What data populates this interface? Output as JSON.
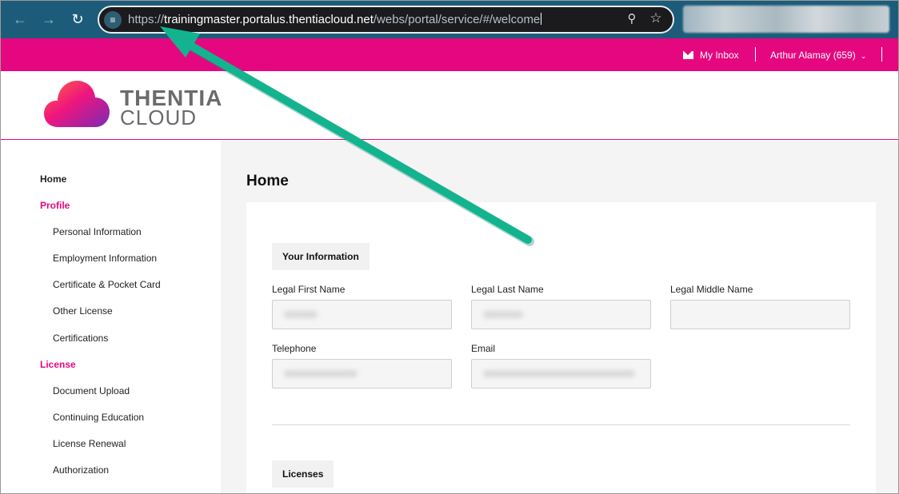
{
  "browser": {
    "url_scheme": "https://",
    "url_host": "trainingmaster.portalus.thentiacloud.net",
    "url_path": "/webs/portal/service/#/welcome",
    "back_icon": "arrow-left",
    "forward_icon": "arrow-right",
    "reload_icon": "reload",
    "site_settings_icon": "tune",
    "zoom_icon": "magnifier-minus",
    "bookmark_icon": "star"
  },
  "header": {
    "inbox_label": "My Inbox",
    "user_label": "Arthur Alamay (659)",
    "accent_color": "#e5077f"
  },
  "logo": {
    "line1": "THENTIA",
    "line2": "CLOUD"
  },
  "sidebar": {
    "items": [
      {
        "label": "Home",
        "kind": "top"
      },
      {
        "label": "Profile",
        "kind": "section"
      },
      {
        "label": "Personal Information",
        "kind": "sub"
      },
      {
        "label": "Employment Information",
        "kind": "sub"
      },
      {
        "label": "Certificate & Pocket Card",
        "kind": "sub"
      },
      {
        "label": "Other License",
        "kind": "sub"
      },
      {
        "label": "Certifications",
        "kind": "sub"
      },
      {
        "label": "License",
        "kind": "section"
      },
      {
        "label": "Document Upload",
        "kind": "sub"
      },
      {
        "label": "Continuing Education",
        "kind": "sub"
      },
      {
        "label": "License Renewal",
        "kind": "sub"
      },
      {
        "label": "Authorization",
        "kind": "sub"
      }
    ]
  },
  "main": {
    "title": "Home",
    "your_information": "Your Information",
    "fields": {
      "first_name_label": "Legal First Name",
      "last_name_label": "Legal Last Name",
      "middle_name_label": "Legal Middle Name",
      "telephone_label": "Telephone",
      "email_label": "Email"
    },
    "licenses": "Licenses"
  },
  "annotation": {
    "arrow_color": "#14b38f"
  }
}
